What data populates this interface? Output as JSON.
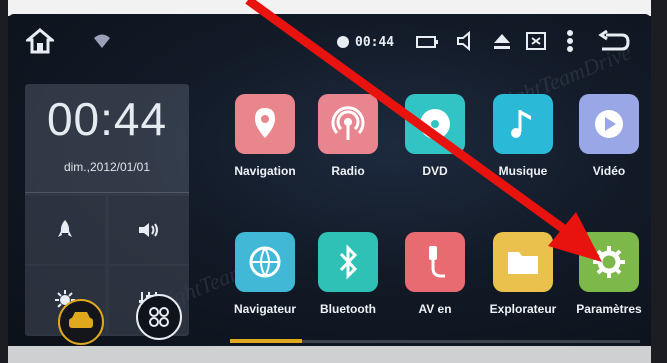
{
  "status_bar": {
    "time": "00:44",
    "icons": [
      "home-icon",
      "wifi-icon",
      "location-dot-icon",
      "battery-icon",
      "volume-icon",
      "eject-icon",
      "screen-icon",
      "menu-icon",
      "back-icon"
    ]
  },
  "clock_widget": {
    "time": "00:44",
    "date": "dim.,2012/01/01",
    "quick_buttons": [
      "rocket-icon",
      "speaker-icon",
      "brightness-icon",
      "equalizer-icon"
    ]
  },
  "apps": [
    {
      "label": "Navigation",
      "color": "#e8868c",
      "icon": "location-pin-icon"
    },
    {
      "label": "Radio",
      "color": "#e9858f",
      "icon": "radio-waves-icon"
    },
    {
      "label": "DVD",
      "color": "#32c4c4",
      "icon": "disc-icon"
    },
    {
      "label": "Musique",
      "color": "#2ab9d6",
      "icon": "music-note-icon"
    },
    {
      "label": "Vidéo",
      "color": "#9aa7e6",
      "icon": "play-icon"
    },
    {
      "label": "Navigateur",
      "color": "#40b8d6",
      "icon": "globe-icon"
    },
    {
      "label": "Bluetooth",
      "color": "#2fc1b5",
      "icon": "bluetooth-icon"
    },
    {
      "label": "AV en",
      "color": "#e86b72",
      "icon": "av-input-icon"
    },
    {
      "label": "Explorateur",
      "color": "#e9c14c",
      "icon": "folder-icon"
    },
    {
      "label": "Paramètres",
      "color": "#7cb84a",
      "icon": "gear-icon"
    }
  ],
  "dock": [
    "car-icon",
    "apps-grid-icon"
  ],
  "watermark": "lightTeamDrive",
  "colors": {
    "accent": "#e0a81c",
    "arrow": "#e8130f"
  }
}
